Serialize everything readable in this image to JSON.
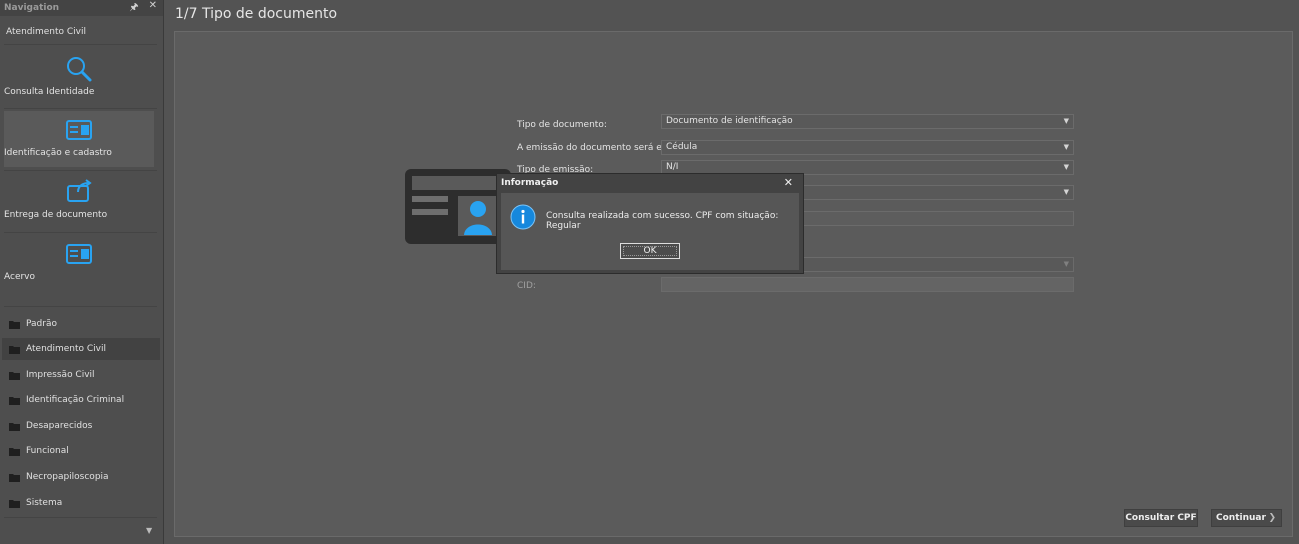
{
  "navigation": {
    "title": "Navigation",
    "pin_icon": "pin-icon",
    "close_icon": "close-icon",
    "section_title": "Atendimento Civil",
    "tiles": [
      {
        "label": "Consulta Identidade",
        "icon": "search-icon"
      },
      {
        "label": "Identificação e cadastro",
        "icon": "id-card-icon"
      },
      {
        "label": "Entrega de documento",
        "icon": "document-delivery-icon"
      },
      {
        "label": "Acervo",
        "icon": "archive-card-icon"
      }
    ],
    "folders": [
      {
        "label": "Padrão"
      },
      {
        "label": "Atendimento Civil"
      },
      {
        "label": "Impressão Civil"
      },
      {
        "label": "Identificação Criminal"
      },
      {
        "label": "Desaparecidos"
      },
      {
        "label": "Funcional"
      },
      {
        "label": "Necropapiloscopia"
      },
      {
        "label": "Sistema"
      }
    ],
    "active_folder": "Atendimento Civil"
  },
  "page": {
    "title": "1/7 Tipo de documento"
  },
  "form": {
    "tipo_documento_label": "Tipo de documento:",
    "tipo_documento_value": "Documento de identificação",
    "emissao_label": "A emissão do documento será em:",
    "emissao_value": "Cédula",
    "tipo_emissao_label": "Tipo de emissão:",
    "tipo_emissao_value": "N/I",
    "cid_label": "CID:"
  },
  "footer": {
    "consultar_cpf_label": "Consultar CPF",
    "continuar_label": "Continuar"
  },
  "dialog": {
    "title": "Informação",
    "close_glyph": "✕",
    "message": "Consulta realizada com sucesso. CPF com situação: Regular",
    "ok_label": "OK",
    "icon": "info-icon"
  },
  "colors": {
    "accent": "#29a3f1",
    "background": "#535353",
    "sidebar": "#4e4e4e",
    "dialog": "#434343"
  }
}
